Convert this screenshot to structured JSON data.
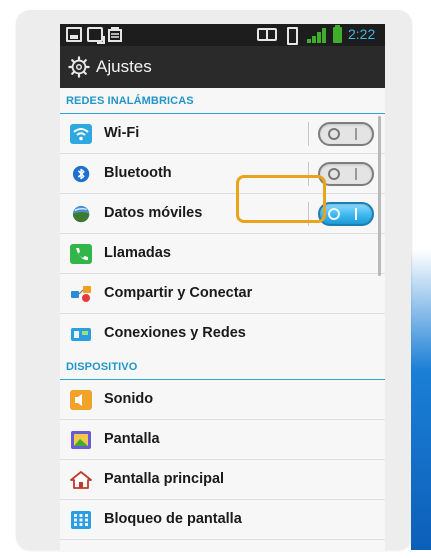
{
  "status_bar": {
    "time": "2:22",
    "icons": [
      "screenshot-icon",
      "message-icon",
      "store-icon",
      "nfc-icon",
      "vibrate-icon",
      "signal-icon",
      "battery-icon"
    ],
    "accent": "#3fb5e5",
    "signal_color": "#3fae2a"
  },
  "header": {
    "title": "Ajustes",
    "icon": "gear-icon"
  },
  "sections": [
    {
      "title": "REDES INALÁMBRICAS",
      "items": [
        {
          "label": "Wi-Fi",
          "icon": "wifi-icon",
          "toggle": "off"
        },
        {
          "label": "Bluetooth",
          "icon": "bluetooth-icon",
          "toggle": "off"
        },
        {
          "label": "Datos móviles",
          "icon": "mobile-data-icon",
          "toggle": "on"
        },
        {
          "label": "Llamadas",
          "icon": "phone-icon"
        },
        {
          "label": "Compartir y Conectar",
          "icon": "share-connect-icon"
        },
        {
          "label": "Conexiones y Redes",
          "icon": "networks-icon"
        }
      ]
    },
    {
      "title": "DISPOSITIVO",
      "items": [
        {
          "label": "Sonido",
          "icon": "sound-icon"
        },
        {
          "label": "Pantalla",
          "icon": "display-icon"
        },
        {
          "label": "Pantalla principal",
          "icon": "home-icon"
        },
        {
          "label": "Bloqueo de pantalla",
          "icon": "lock-screen-icon"
        }
      ]
    }
  ],
  "colors": {
    "section_header": "#2196c9",
    "toggle_on": "#3db7ef",
    "highlight": "#e9a31c"
  }
}
